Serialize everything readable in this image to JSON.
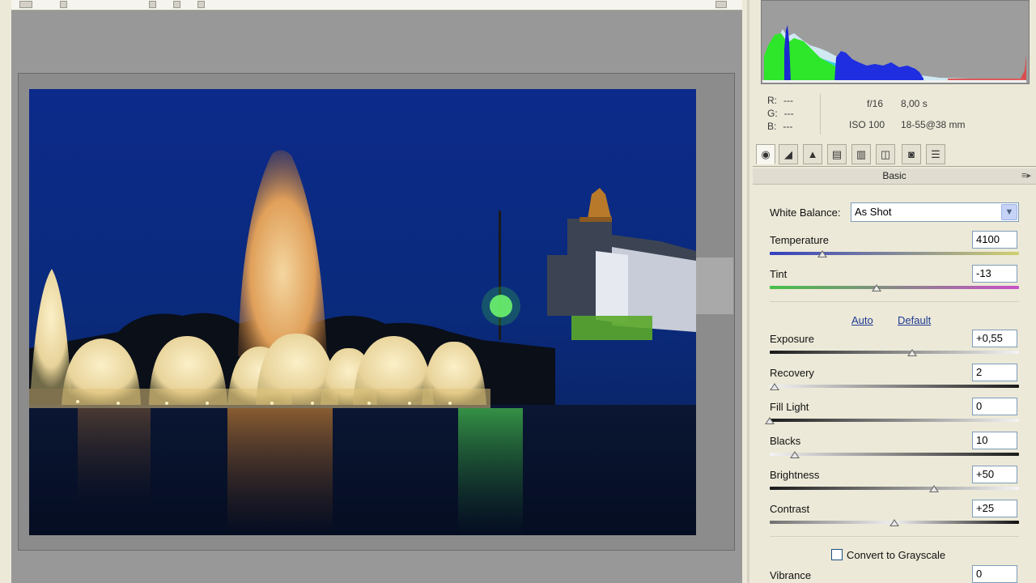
{
  "histogram": {
    "r_label": "R:",
    "g_label": "G:",
    "b_label": "B:",
    "r_value": "---",
    "g_value": "---",
    "b_value": "---"
  },
  "exif": {
    "aperture": "f/16",
    "shutter": "8,00 s",
    "iso": "ISO 100",
    "lens": "18-55@38 mm"
  },
  "tabs": [
    {
      "name": "basic-tab-icon",
      "glyph": "◉"
    },
    {
      "name": "tone-curve-tab-icon",
      "glyph": "◢"
    },
    {
      "name": "detail-tab-icon",
      "glyph": "▲"
    },
    {
      "name": "hsl-tab-icon",
      "glyph": "▤"
    },
    {
      "name": "split-toning-tab-icon",
      "glyph": "▥"
    },
    {
      "name": "lens-corrections-tab-icon",
      "glyph": "◫"
    },
    {
      "name": "camera-calibration-tab-icon",
      "glyph": "◙"
    },
    {
      "name": "presets-tab-icon",
      "glyph": "☰"
    }
  ],
  "section_title": "Basic",
  "white_balance": {
    "label": "White Balance:",
    "value": "As Shot"
  },
  "temperature": {
    "label": "Temperature",
    "value": "4100",
    "level": 0.21
  },
  "tint": {
    "label": "Tint",
    "value": "-13",
    "level": 0.43
  },
  "auto_label": "Auto",
  "default_label": "Default",
  "exposure": {
    "label": "Exposure",
    "value": "+0,55",
    "level": 0.57
  },
  "recovery": {
    "label": "Recovery",
    "value": "2",
    "level": 0.02
  },
  "fill_light": {
    "label": "Fill Light",
    "value": "0",
    "level": 0.0
  },
  "blacks": {
    "label": "Blacks",
    "value": "10",
    "level": 0.1
  },
  "brightness": {
    "label": "Brightness",
    "value": "+50",
    "level": 0.66
  },
  "contrast": {
    "label": "Contrast",
    "value": "+25",
    "level": 0.5
  },
  "grayscale_label": "Convert to Grayscale",
  "vibrance": {
    "label": "Vibrance",
    "value": "0"
  },
  "colors": {
    "link": "#1f3a93",
    "field_border": "#7f9db9",
    "panel_bg": "#ece9d8",
    "preview_bg": "#989898"
  }
}
